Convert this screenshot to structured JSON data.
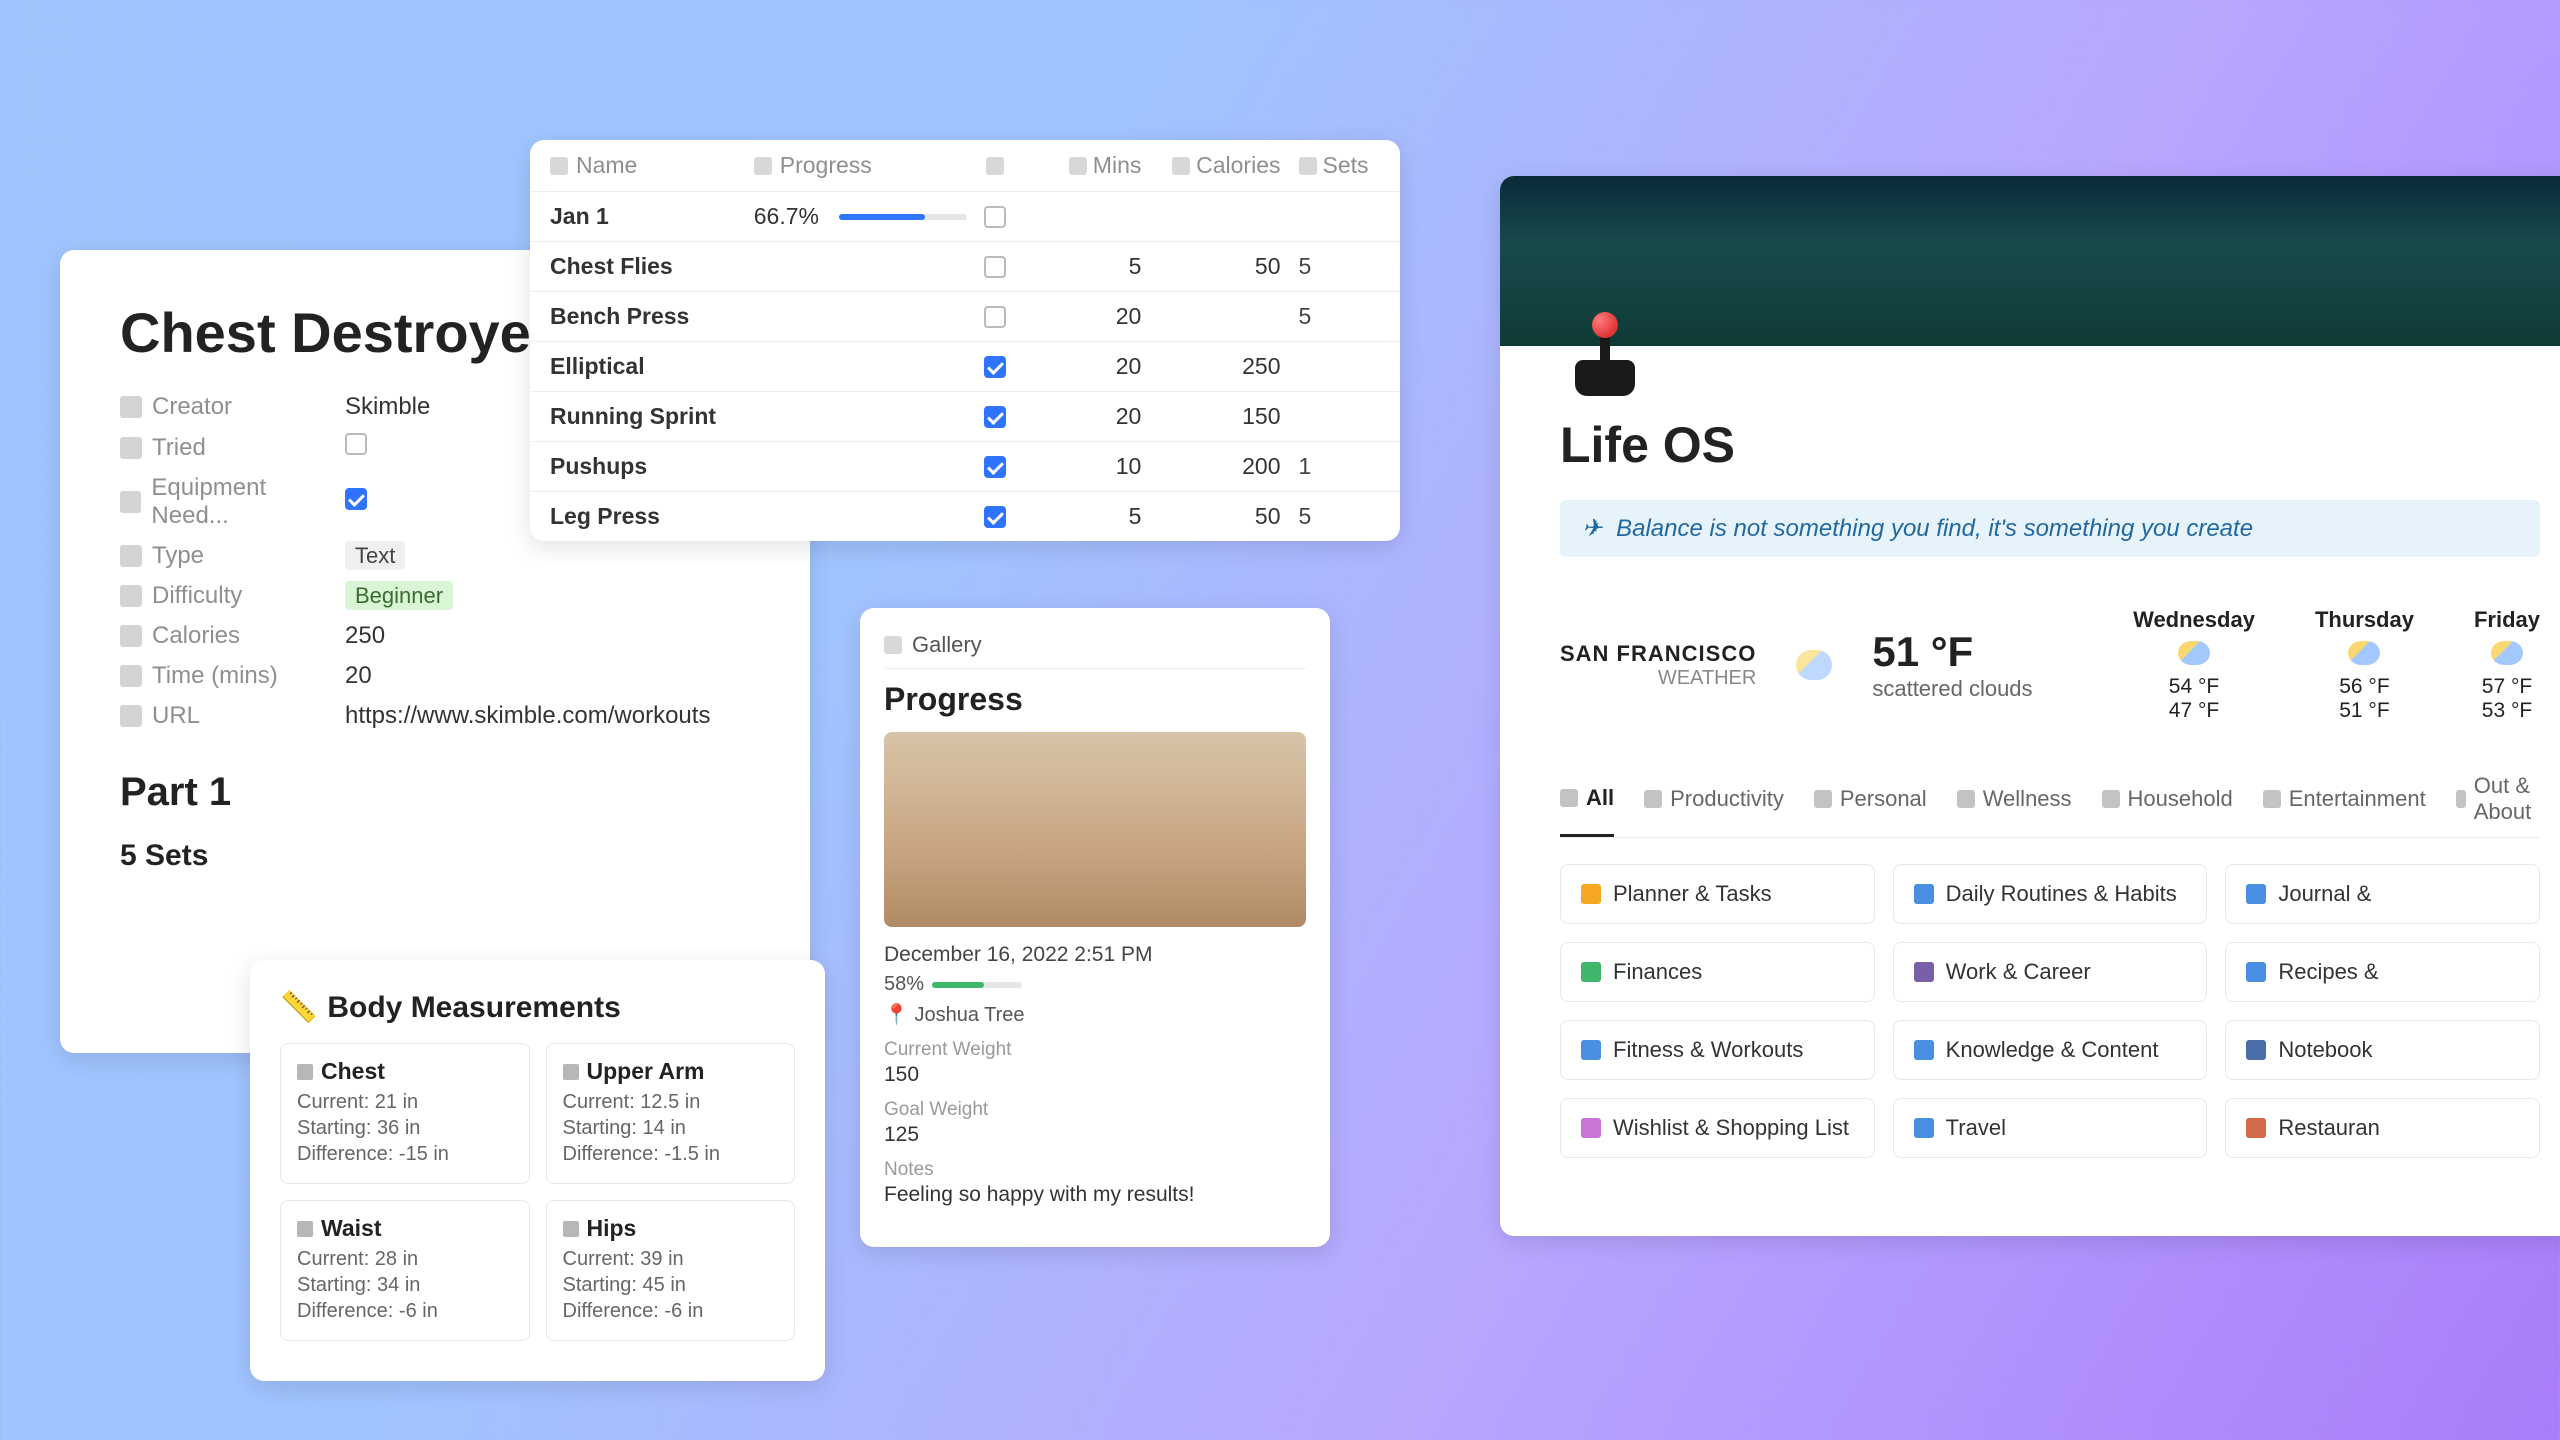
{
  "chest": {
    "title": "Chest Destroyer",
    "props": {
      "creator_label": "Creator",
      "creator": "Skimble",
      "tried_label": "Tried",
      "tried": false,
      "equip_label": "Equipment Need...",
      "equip": true,
      "type_label": "Type",
      "type": "Text",
      "diff_label": "Difficulty",
      "diff": "Beginner",
      "cal_label": "Calories",
      "cal": "250",
      "time_label": "Time (mins)",
      "time": "20",
      "url_label": "URL",
      "url": "https://www.skimble.com/workouts"
    },
    "part_heading": "Part 1",
    "sets_heading": "5 Sets"
  },
  "table": {
    "headers": {
      "name": "Name",
      "progress": "Progress",
      "mins": "Mins",
      "cal": "Calories",
      "sets": "Sets"
    },
    "rows": [
      {
        "name": "Jan 1",
        "progress": "66.7%",
        "progress_pct": 67,
        "checked": false,
        "mins": "",
        "cal": "",
        "sets": ""
      },
      {
        "name": "Chest Flies",
        "progress": "",
        "progress_pct": null,
        "checked": false,
        "mins": "5",
        "cal": "50",
        "sets": "5"
      },
      {
        "name": "Bench Press",
        "progress": "",
        "progress_pct": null,
        "checked": false,
        "mins": "20",
        "cal": "",
        "sets": "5"
      },
      {
        "name": "Elliptical",
        "progress": "",
        "progress_pct": null,
        "checked": true,
        "mins": "20",
        "cal": "250",
        "sets": ""
      },
      {
        "name": "Running Sprint",
        "progress": "",
        "progress_pct": null,
        "checked": true,
        "mins": "20",
        "cal": "150",
        "sets": ""
      },
      {
        "name": "Pushups",
        "progress": "",
        "progress_pct": null,
        "checked": true,
        "mins": "10",
        "cal": "200",
        "sets": "1"
      },
      {
        "name": "Leg Press",
        "progress": "",
        "progress_pct": null,
        "checked": true,
        "mins": "5",
        "cal": "50",
        "sets": "5"
      }
    ]
  },
  "measurements": {
    "title": "Body Measurements",
    "icon": "📏",
    "items": [
      {
        "name": "Chest",
        "current": "Current: 21 in",
        "starting": "Starting: 36 in",
        "diff": "Difference: -15 in"
      },
      {
        "name": "Upper Arm",
        "current": "Current: 12.5 in",
        "starting": "Starting: 14 in",
        "diff": "Difference: -1.5 in"
      },
      {
        "name": "Waist",
        "current": "Current: 28 in",
        "starting": "Starting: 34 in",
        "diff": "Difference: -6 in"
      },
      {
        "name": "Hips",
        "current": "Current: 39 in",
        "starting": "Starting: 45 in",
        "diff": "Difference: -6 in"
      }
    ]
  },
  "progress": {
    "gallery_label": "Gallery",
    "heading": "Progress",
    "date": "December 16, 2022 2:51 PM",
    "pct": "58%",
    "pct_val": 58,
    "location": "Joshua Tree",
    "cw_label": "Current Weight",
    "cw": "150",
    "gw_label": "Goal Weight",
    "gw": "125",
    "notes_label": "Notes",
    "notes": "Feeling so happy with my results!"
  },
  "life": {
    "title": "Life OS",
    "quote": "Balance is not something you find, it's something you create",
    "weather": {
      "city": "SAN FRANCISCO",
      "sub": "WEATHER",
      "temp": "51 °F",
      "cond": "scattered clouds",
      "days": [
        {
          "name": "Wednesday",
          "hi": "54 °F",
          "lo": "47 °F"
        },
        {
          "name": "Thursday",
          "hi": "56 °F",
          "lo": "51 °F"
        },
        {
          "name": "Friday",
          "hi": "57 °F",
          "lo": "53 °F"
        }
      ]
    },
    "tabs": [
      "All",
      "Productivity",
      "Personal",
      "Wellness",
      "Household",
      "Entertainment",
      "Out & About"
    ],
    "links": [
      {
        "label": "Planner & Tasks",
        "color": "#f5a623"
      },
      {
        "label": "Daily Routines & Habits",
        "color": "#4a90e2"
      },
      {
        "label": "Journal &",
        "color": "#4a90e2"
      },
      {
        "label": "Finances",
        "color": "#3fb76a"
      },
      {
        "label": "Work & Career",
        "color": "#7a5ea8"
      },
      {
        "label": "Recipes &",
        "color": "#4a90e2"
      },
      {
        "label": "Fitness & Workouts",
        "color": "#4a90e2"
      },
      {
        "label": "Knowledge & Content",
        "color": "#4a90e2"
      },
      {
        "label": "Notebook",
        "color": "#4a6fa8"
      },
      {
        "label": "Wishlist & Shopping List",
        "color": "#c776d6"
      },
      {
        "label": "Travel",
        "color": "#4a90e2"
      },
      {
        "label": "Restauran",
        "color": "#d06a4a"
      }
    ]
  }
}
